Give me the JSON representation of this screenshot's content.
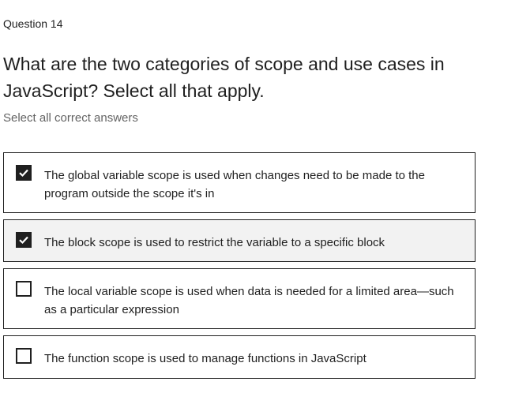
{
  "question": {
    "number_label": "Question 14",
    "title": "What are the two categories of scope and use cases in JavaScript? Select all that apply.",
    "instruction": "Select all correct answers"
  },
  "options": [
    {
      "text": "The global variable scope is used when changes need to be made to the program outside the scope it's in",
      "checked": true
    },
    {
      "text": "The block scope is used to restrict the variable to a specific block",
      "checked": true
    },
    {
      "text": "The local variable scope is used when data is needed for a limited area—such as a particular expression",
      "checked": false
    },
    {
      "text": "The function scope is used to manage functions in JavaScript",
      "checked": false
    }
  ],
  "colors": {
    "text": "#1f1f1f",
    "muted": "#636363",
    "hover_background": "#f2f2f2"
  }
}
